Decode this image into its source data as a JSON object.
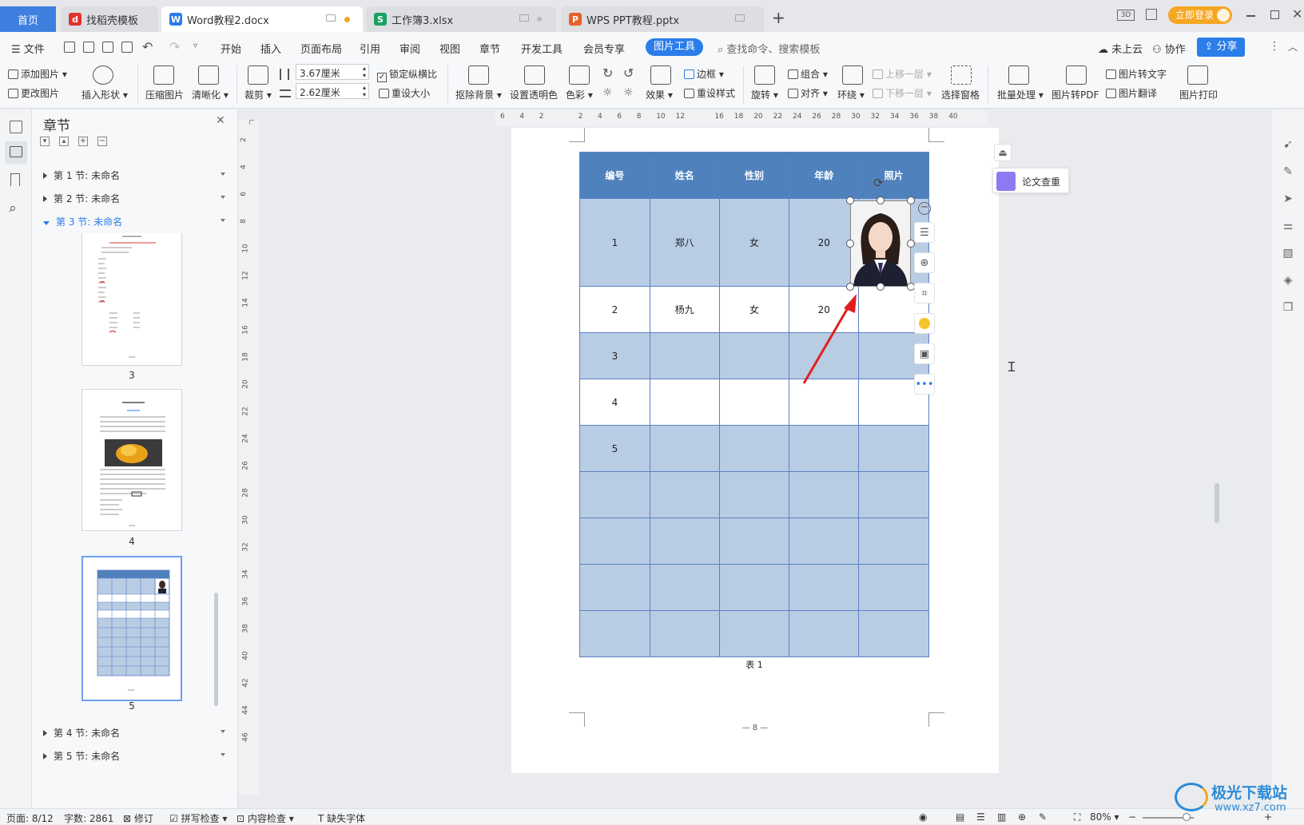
{
  "tabs": [
    {
      "label": "首页",
      "active": true
    },
    {
      "label": "找稻壳模板",
      "active": false
    },
    {
      "label": "Word教程2.docx",
      "active": false
    },
    {
      "label": "工作簿3.xlsx",
      "active": false
    },
    {
      "label": "WPS PPT教程.pptx",
      "active": false
    }
  ],
  "window": {
    "login_label": "立即登录"
  },
  "menu": {
    "file": "文件",
    "items": [
      "开始",
      "插入",
      "页面布局",
      "引用",
      "审阅",
      "视图",
      "章节",
      "开发工具",
      "会员专享"
    ],
    "active_tool": "图片工具",
    "search_placeholder": "查找命令、搜索模板",
    "cloud": "未上云",
    "collab": "协作",
    "share": "分享"
  },
  "ribbon": {
    "add_image": "添加图片",
    "change_image": "更改图片",
    "insert_shape": "插入形状",
    "compress": "压缩图片",
    "sharpen": "清晰化",
    "crop": "裁剪",
    "width": "3.67厘米",
    "height": "2.62厘米",
    "lock_ratio": "锁定纵横比",
    "reset_size": "重设大小",
    "remove_bg": "抠除背景",
    "set_transparent": "设置透明色",
    "color": "色彩",
    "effects": "效果",
    "border": "边框",
    "reset_style": "重设样式",
    "rotate": "旋转",
    "group": "组合",
    "align": "对齐",
    "wrap": "环绕",
    "bring_forward": "上移一层",
    "send_backward": "下移一层",
    "select_pane": "选择窗格",
    "batch": "批量处理",
    "to_pdf": "图片转PDF",
    "to_text": "图片转文字",
    "translate": "图片翻译",
    "print": "图片打印"
  },
  "nav_panel": {
    "title": "章节",
    "sections": [
      {
        "label": "第 1 节: 未命名"
      },
      {
        "label": "第 2 节: 未命名"
      },
      {
        "label": "第 3 节: 未命名"
      },
      {
        "label": "第 4 节: 未命名"
      },
      {
        "label": "第 5 节: 未命名"
      }
    ],
    "thumbnails": [
      "3",
      "4",
      "5"
    ]
  },
  "ruler": {
    "h_ticks": [
      "6",
      "4",
      "2",
      "",
      "2",
      "4",
      "6",
      "8",
      "10",
      "12",
      "",
      "16",
      "18",
      "20",
      "22",
      "24",
      "26",
      "28",
      "30",
      "32",
      "34",
      "36",
      "38",
      "40"
    ],
    "v_ticks": [
      "2",
      "4",
      "6",
      "8",
      "10",
      "12",
      "14",
      "16",
      "18",
      "20",
      "22",
      "24",
      "26",
      "28",
      "30",
      "32",
      "34",
      "36",
      "38",
      "40",
      "42",
      "44",
      "46"
    ]
  },
  "table": {
    "headers": [
      "编号",
      "姓名",
      "性别",
      "年龄",
      "照片"
    ],
    "rows": [
      [
        "1",
        "郑八",
        "女",
        "20",
        ""
      ],
      [
        "2",
        "杨九",
        "女",
        "20",
        ""
      ],
      [
        "3",
        "",
        "",
        "",
        ""
      ],
      [
        "4",
        "",
        "",
        "",
        ""
      ],
      [
        "5",
        "",
        "",
        "",
        ""
      ],
      [
        "",
        "",
        "",
        "",
        ""
      ],
      [
        "",
        "",
        "",
        "",
        ""
      ],
      [
        "",
        "",
        "",
        "",
        ""
      ],
      [
        "",
        "",
        "",
        "",
        ""
      ]
    ],
    "caption": "表 1"
  },
  "page_footer": "— 8 —",
  "side_tool": {
    "label": "论文查重"
  },
  "status": {
    "page": "页面: 8/12",
    "words": "字数: 2861",
    "revise": "修订",
    "spell": "拼写检查",
    "content": "内容检查",
    "missing_font": "缺失字体",
    "zoom": "80%"
  },
  "watermark": {
    "text": "极光下载站",
    "url": "www.xz7.com"
  },
  "colors": {
    "accent": "#2b7de9",
    "header_blue": "#4f81bd",
    "row_blue": "#b8cce4",
    "arrow_red": "#e02020",
    "login_orange": "#f5a623"
  }
}
